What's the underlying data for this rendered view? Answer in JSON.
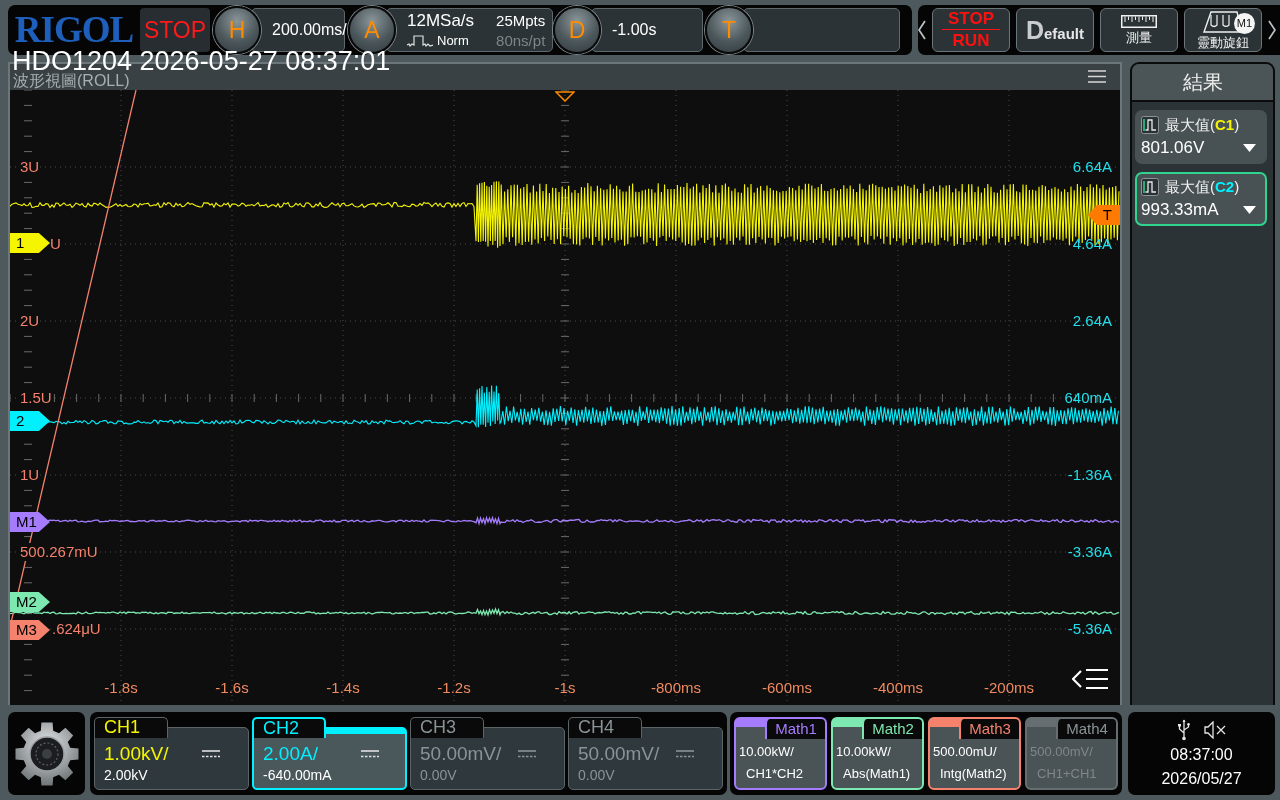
{
  "top_bar": {
    "logo": "RIGOL",
    "run_state": "STOP",
    "horizontal": {
      "badge": "H",
      "scale": "200.00ms/"
    },
    "acquisition": {
      "badge": "A",
      "sample_rate": "12MSa/s",
      "mode": "Norm",
      "memory_depth": "25Mpts",
      "sample_interval": "80ns/pt"
    },
    "delay": {
      "badge": "D",
      "offset": "-1.00s"
    },
    "trigger": {
      "badge": "T"
    }
  },
  "toolbar": [
    {
      "kind": "stop_run",
      "label": "STOP",
      "second_label": "RUN"
    },
    {
      "kind": "default",
      "label": "Default"
    },
    {
      "kind": "ruler",
      "label": "測量"
    },
    {
      "kind": "knob",
      "label": "靈動旋鈕",
      "badge": "M1"
    }
  ],
  "overlay_title": "HDO1204 2026-05-27 08:37:01",
  "waveform_view": {
    "title": "波形視圖(ROLL)",
    "left_scale": [
      "3U",
      "U",
      "2U",
      "1.5U",
      "1U",
      "500.267mU",
      ".624μU"
    ],
    "right_scale": [
      "6.64A",
      "4.64A",
      "2.64A",
      "640mA",
      "-1.36A",
      "-3.36A",
      "-5.36A"
    ],
    "time_axis": [
      "-1.8s",
      "-1.6s",
      "-1.4s",
      "-1.2s",
      "-1s",
      "-800ms",
      "-600ms",
      "-400ms",
      "-200ms"
    ],
    "markers": [
      {
        "label": "1",
        "color": "#f5f500"
      },
      {
        "label": "2",
        "color": "#00f0ff"
      },
      {
        "label": "M1",
        "color": "#a67cff"
      },
      {
        "label": "M2",
        "color": "#7de8b0"
      },
      {
        "label": "M3",
        "color": "#f4826d"
      }
    ],
    "trigger_level": "T"
  },
  "results": {
    "title": "結果",
    "measurements": [
      {
        "label": "最大值(**C1**)",
        "color": "#f5f500",
        "value": "801.06V",
        "selected": false
      },
      {
        "label": "最大值(**C2**)",
        "color": "#00f0ff",
        "value": "993.33mA",
        "selected": true
      }
    ]
  },
  "channels": [
    {
      "name": "CH1",
      "scale": "1.00kV/",
      "offset": "2.00kV",
      "color": "#f5f500",
      "enabled": true,
      "selected": false
    },
    {
      "name": "CH2",
      "scale": "2.00A/",
      "offset": "-640.00mA",
      "color": "#00f0ff",
      "enabled": true,
      "selected": true
    },
    {
      "name": "CH3",
      "scale": "50.00mV/",
      "offset": "0.00V",
      "enabled": false,
      "selected": false
    },
    {
      "name": "CH4",
      "scale": "50.00mV/",
      "offset": "0.00V",
      "enabled": false,
      "selected": false
    }
  ],
  "math": [
    {
      "name": "Math1",
      "scale": "10.00kW/",
      "source": "CH1*CH2",
      "color": "#a67cff",
      "enabled": true
    },
    {
      "name": "Math2",
      "scale": "10.00kW/",
      "source": "Abs(Math1)",
      "color": "#7de8b0",
      "enabled": true
    },
    {
      "name": "Math3",
      "scale": "500.00mU/",
      "source": "Intg(Math2)",
      "color": "#f4826d",
      "enabled": true
    },
    {
      "name": "Math4",
      "scale": "500.00mV/",
      "source": "CH1+CH1",
      "enabled": false
    }
  ],
  "status": {
    "muted": true,
    "time": "08:37:00",
    "date": "2026/05/27"
  }
}
